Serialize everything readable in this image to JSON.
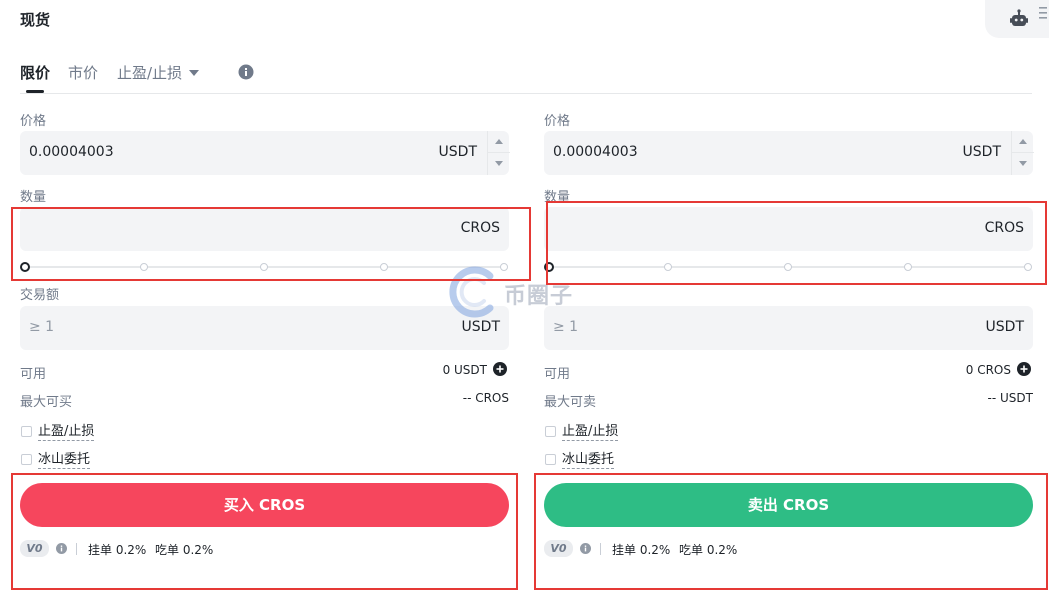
{
  "header": {
    "title": "现货"
  },
  "tabs": {
    "limit": "限价",
    "market": "市价",
    "tpsl": "止盈/止损"
  },
  "buy": {
    "price_label": "价格",
    "price_value": "0.00004003",
    "price_unit": "USDT",
    "amount_label": "数量",
    "amount_unit": "CROS",
    "total_label": "交易额",
    "total_placeholder": "≥ 1",
    "total_unit": "USDT",
    "available_label": "可用",
    "available_value": "0 USDT",
    "max_label": "最大可买",
    "max_value": "-- CROS",
    "tpsl_label": "止盈/止损",
    "iceberg_label": "冰山委托",
    "button_label": "买入 CROS",
    "fee": {
      "tier": "V0",
      "maker": "挂单 0.2%",
      "taker": "吃单 0.2%"
    },
    "slider_percent": 0
  },
  "sell": {
    "price_label": "价格",
    "price_value": "0.00004003",
    "price_unit": "USDT",
    "amount_label": "数量",
    "amount_unit": "CROS",
    "total_label": "",
    "total_placeholder": "≥ 1",
    "total_unit": "USDT",
    "available_label": "可用",
    "available_value": "0 CROS",
    "max_label": "最大可卖",
    "max_value": "-- USDT",
    "tpsl_label": "止盈/止损",
    "iceberg_label": "冰山委托",
    "button_label": "卖出 CROS",
    "fee": {
      "tier": "V0",
      "maker": "挂单 0.2%",
      "taker": "吃单 0.2%"
    },
    "slider_percent": 0
  },
  "watermark": {
    "text": "币圈子"
  },
  "icons": {
    "robot": "robot-icon",
    "menu": "menu-icon",
    "info": "info-icon",
    "plus": "plus-circle-icon",
    "caret": "caret-down-icon"
  },
  "colors": {
    "buy": "#f6465d",
    "sell": "#2ebd85",
    "annotation": "#e53935"
  }
}
